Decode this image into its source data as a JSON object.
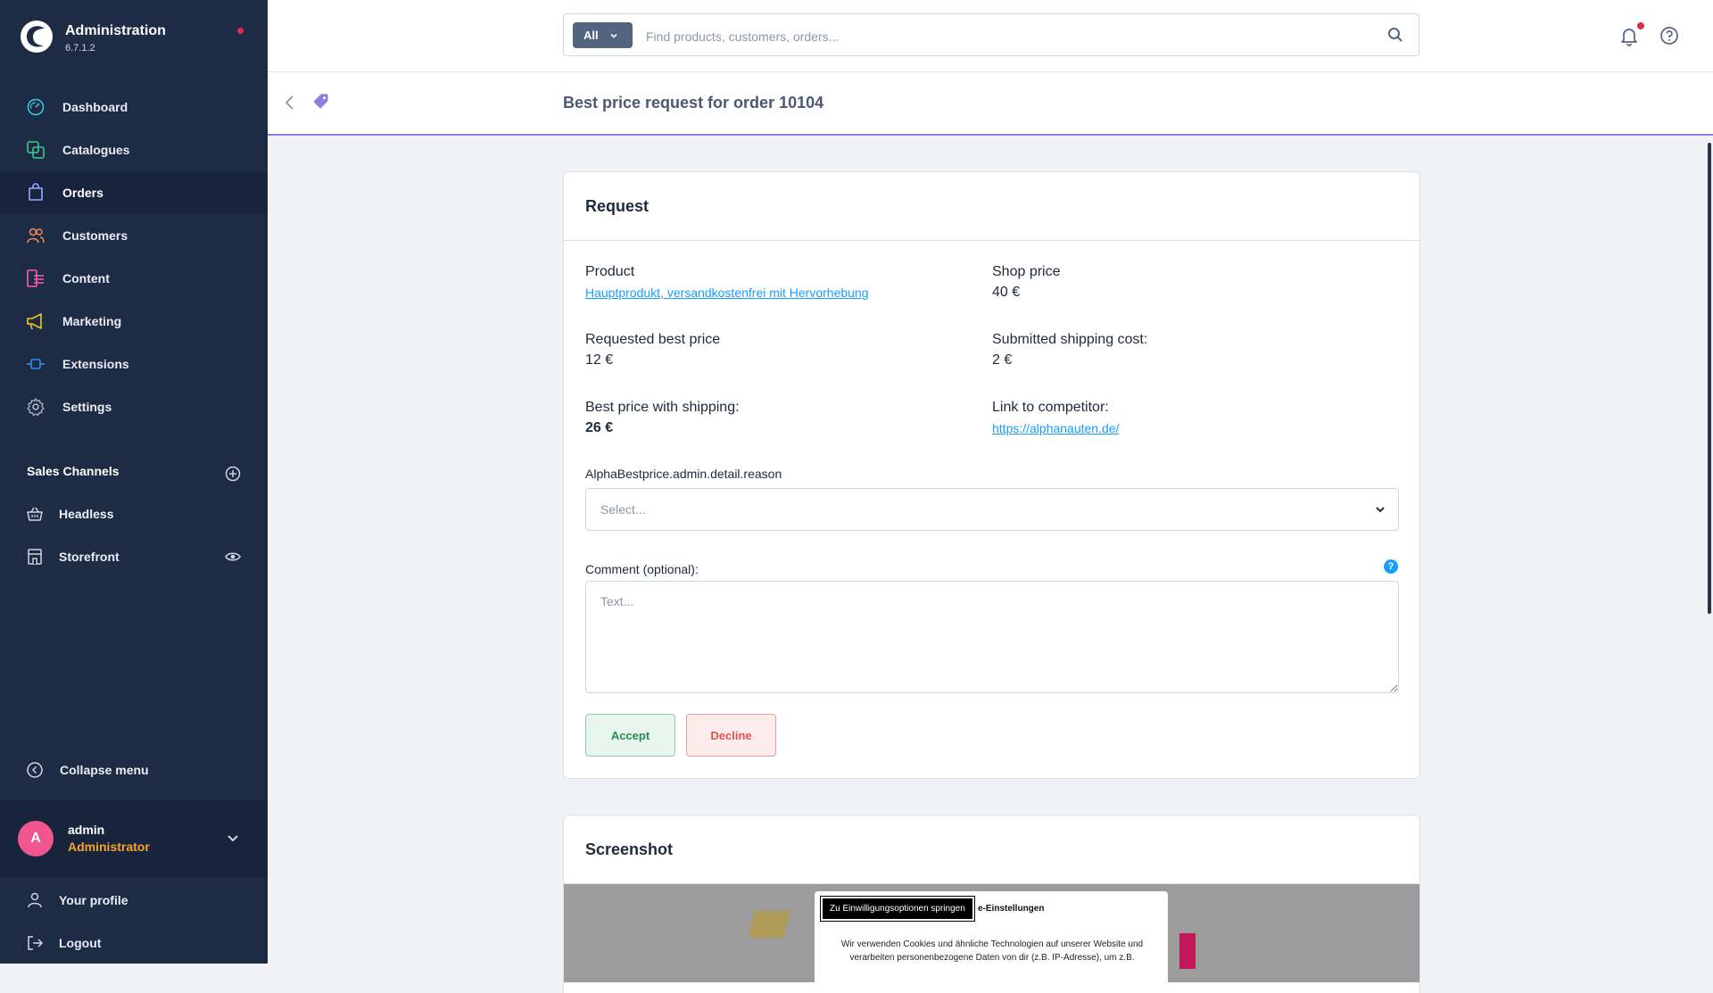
{
  "app": {
    "title": "Administration",
    "version": "6.7.1.2"
  },
  "nav": {
    "items": [
      {
        "label": "Dashboard",
        "icon": "dashboard-icon"
      },
      {
        "label": "Catalogues",
        "icon": "catalogues-icon"
      },
      {
        "label": "Orders",
        "icon": "orders-icon",
        "active": true
      },
      {
        "label": "Customers",
        "icon": "customers-icon"
      },
      {
        "label": "Content",
        "icon": "content-icon"
      },
      {
        "label": "Marketing",
        "icon": "marketing-icon"
      },
      {
        "label": "Extensions",
        "icon": "extensions-icon"
      },
      {
        "label": "Settings",
        "icon": "settings-icon"
      }
    ],
    "sales_channels_title": "Sales Channels",
    "sales_channels": [
      {
        "label": "Headless",
        "icon": "basket-icon"
      },
      {
        "label": "Storefront",
        "icon": "storefront-icon"
      }
    ],
    "collapse_label": "Collapse menu"
  },
  "user": {
    "initial": "A",
    "name": "admin",
    "role": "Administrator",
    "links": [
      {
        "label": "Your profile",
        "icon": "profile-icon"
      },
      {
        "label": "Logout",
        "icon": "logout-icon"
      }
    ]
  },
  "search": {
    "scope": "All",
    "placeholder": "Find products, customers, orders..."
  },
  "page": {
    "title": "Best price request for order 10104"
  },
  "request": {
    "title": "Request",
    "product_label": "Product",
    "product_value": "Hauptprodukt, versandkostenfrei mit Hervorhebung",
    "shop_price_label": "Shop price",
    "shop_price_value": "40 €",
    "requested_label": "Requested best price",
    "requested_value": "12 €",
    "shipping_label": "Submitted shipping cost:",
    "shipping_value": "2 €",
    "best_with_shipping_label": "Best price with shipping:",
    "best_with_shipping_value": "26 €",
    "competitor_label": "Link to competitor:",
    "competitor_value": "https://alphanauten.de/",
    "reason_label": "AlphaBestprice.admin.detail.reason",
    "reason_placeholder": "Select...",
    "comment_label": "Comment (optional):",
    "comment_placeholder": "Text...",
    "help_glyph": "?",
    "accept_label": "Accept",
    "decline_label": "Decline"
  },
  "screenshot": {
    "title": "Screenshot",
    "cookie_skip": "Zu Einwilligungsoptionen springen",
    "cookie_title": "e-Einstellungen",
    "cookie_text": "Wir verwenden Cookies und ähnliche Technologien auf unserer Website und verarbeiten personenbezogene Daten von dir (z.B. IP-Adresse), um z.B."
  },
  "colors": {
    "sidebar": "#1e2b45",
    "accent_purple": "#8a80dc",
    "link": "#189eff",
    "accept": "#2b8b57",
    "decline": "#e2524f",
    "role": "#f7a42f"
  }
}
